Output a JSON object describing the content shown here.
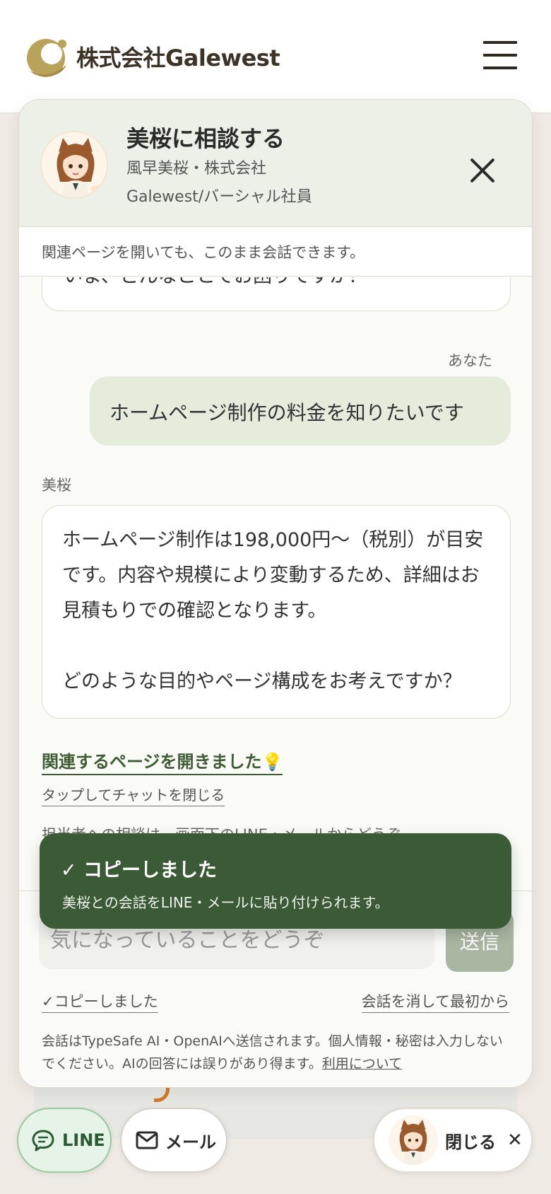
{
  "site": {
    "logo_text": "株式会社Galewest"
  },
  "panel": {
    "title": "美桜に相談する",
    "subtitle": "風早美桜・株式会社Galewest/バーシャル社員",
    "notice": "関連ページを開いても、このまま会話できます。"
  },
  "chat": {
    "previous_ai_message": "いま、どんなことでお困りですか？",
    "user_label": "あなた",
    "user_message": "ホームページ制作の料金を知りたいです",
    "ai_label": "美桜",
    "ai_message_1": "ホームページ制作は198,000円〜（税別）が目安です。内容や規模により変動するため、詳細はお見積もりでの確認となります。",
    "ai_message_2": "どのような目的やページ構成をお考えですか？",
    "related_link": "関連するページを開きました💡",
    "tap_close": "タップしてチャットを閉じる",
    "contact_hint": "担当者への相談は、画面下のLINE・メールからどうぞ。"
  },
  "input": {
    "placeholder": "気になっていることをどうぞ",
    "send_label": "送信",
    "copied_label": "✓コピーしました",
    "reset_label": "会話を消して最初から",
    "disclaimer": "会話はTypeSafe AI・OpenAIへ送信されます。個人情報・秘密は入力しないでください。AIの回答には誤りがあり得ます。",
    "terms_link": "利用について"
  },
  "toast": {
    "title": "✓ コピーしました",
    "message": "美桜との会話をLINE・メールに貼り付けられます。"
  },
  "fab": {
    "line_label": "LINE",
    "mail_label": "メール",
    "close_label": "閉じる"
  },
  "colors": {
    "brand_green": "#3b5a36",
    "logo_gold": "#b9a25a",
    "header_tint": "#edf0e6"
  },
  "icons": [
    "hamburger-icon",
    "close-icon",
    "chat-bubble-icon",
    "mail-icon"
  ]
}
